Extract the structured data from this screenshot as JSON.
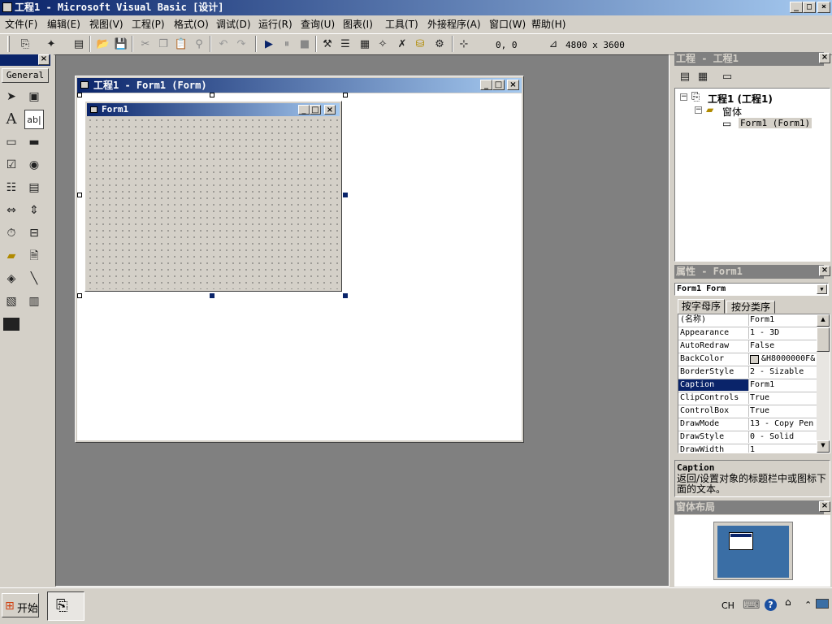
{
  "window": {
    "title": "工程1 - Microsoft Visual Basic [设计]"
  },
  "menu": [
    "文件(F)",
    "编辑(E)",
    "视图(V)",
    "工程(P)",
    "格式(O)",
    "调试(D)",
    "运行(R)",
    "查询(U)",
    "图表(I)",
    "工具(T)",
    "外接程序(A)",
    "窗口(W)",
    "帮助(H)"
  ],
  "toolbar": {
    "position": "0, 0",
    "size": "4800 x 3600"
  },
  "toolbox": {
    "tab_label": "General"
  },
  "designer": {
    "title": "工程1 - Form1 (Form)",
    "form_caption": "Form1"
  },
  "project_explorer": {
    "title": "工程 - 工程1",
    "root": "工程1 (工程1)",
    "folder": "窗体",
    "item": "Form1 (Form1)"
  },
  "properties": {
    "title": "属性 - Form1",
    "object_selector": "Form1 Form",
    "tabs": [
      "按字母序",
      "按分类序"
    ],
    "rows": [
      {
        "name": "(名称)",
        "value": "Form1"
      },
      {
        "name": "Appearance",
        "value": "1 - 3D"
      },
      {
        "name": "AutoRedraw",
        "value": "False"
      },
      {
        "name": "BackColor",
        "value": "&H8000000F&"
      },
      {
        "name": "BorderStyle",
        "value": "2 - Sizable"
      },
      {
        "name": "Caption",
        "value": "Form1"
      },
      {
        "name": "ClipControls",
        "value": "True"
      },
      {
        "name": "ControlBox",
        "value": "True"
      },
      {
        "name": "DrawMode",
        "value": "13 - Copy Pen"
      },
      {
        "name": "DrawStyle",
        "value": "0 - Solid"
      },
      {
        "name": "DrawWidth",
        "value": "1"
      }
    ],
    "selected_row": 5,
    "desc_title": "Caption",
    "desc_text": "返回/设置对象的标题栏中或图标下面的文本。"
  },
  "form_layout": {
    "title": "窗体布局"
  },
  "taskbar": {
    "start_label": "开始",
    "lang": "CH"
  }
}
